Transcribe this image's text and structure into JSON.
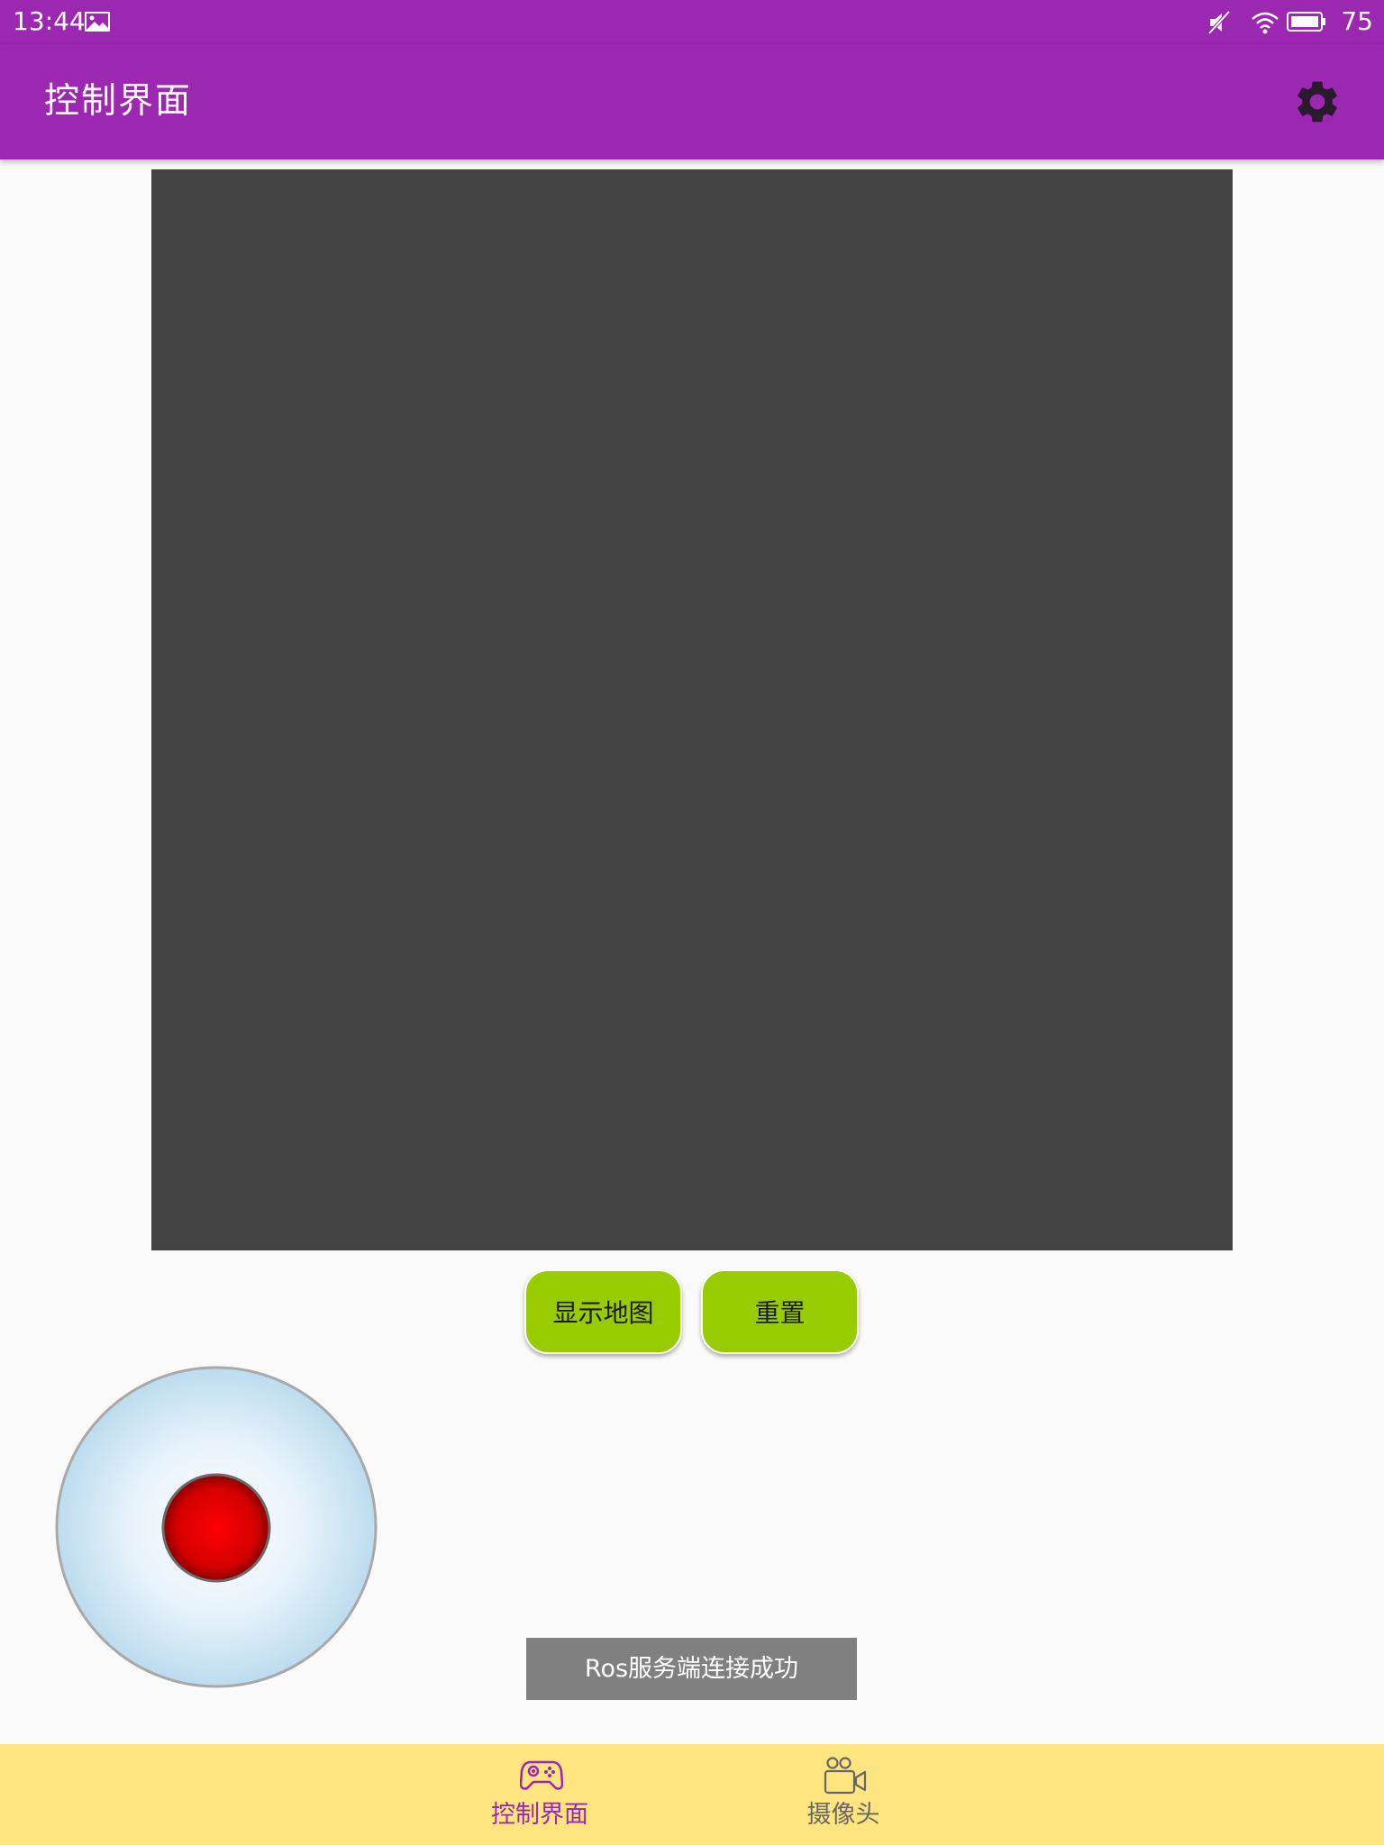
{
  "status_bar": {
    "time": "13:44",
    "battery": "75",
    "icons": [
      "image-icon",
      "mute-icon",
      "wifi-icon",
      "battery-icon"
    ]
  },
  "app_bar": {
    "title": "控制界面",
    "settings_icon": "gear-icon"
  },
  "colors": {
    "primary": "#9c27b0",
    "button_green": "#99cc00",
    "map_background": "#444444",
    "bottom_nav": "#ffe57f",
    "toast": "#808080",
    "joystick_knob": "#ff0000"
  },
  "buttons": {
    "show_map": "显示地图",
    "reset": "重置"
  },
  "toast": {
    "message": "Ros服务端连接成功"
  },
  "bottom_nav": {
    "items": [
      {
        "label": "控制界面",
        "icon": "gamepad-icon",
        "active": true
      },
      {
        "label": "摄像头",
        "icon": "video-camera-icon",
        "active": false
      }
    ]
  }
}
